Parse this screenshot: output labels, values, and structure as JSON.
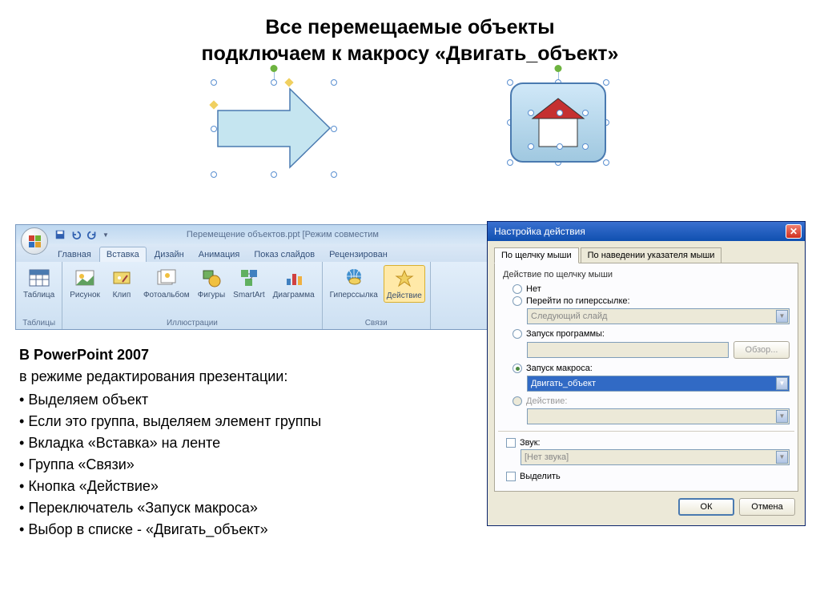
{
  "title_line1": "Все перемещаемые объекты",
  "title_line2": "подключаем к макросу «Двигать_объект»",
  "ribbon": {
    "file_title": "Перемещение объектов.ppt [Режим совместим",
    "tabs": [
      "Главная",
      "Вставка",
      "Дизайн",
      "Анимация",
      "Показ слайдов",
      "Рецензирован"
    ],
    "active_tab_index": 1,
    "groups": {
      "tables": {
        "label": "Таблицы",
        "items": [
          {
            "label": "Таблица"
          }
        ]
      },
      "illustrations": {
        "label": "Иллюстрации",
        "items": [
          {
            "label": "Рисунок"
          },
          {
            "label": "Клип"
          },
          {
            "label": "Фотоальбом"
          },
          {
            "label": "Фигуры"
          },
          {
            "label": "SmartArt"
          },
          {
            "label": "Диаграмма"
          }
        ]
      },
      "links": {
        "label": "Связи",
        "items": [
          {
            "label": "Гиперссылка"
          },
          {
            "label": "Действие",
            "selected": true
          }
        ]
      }
    }
  },
  "dialog": {
    "title": "Настройка действия",
    "tabs": [
      "По щелчку мыши",
      "По наведении указателя мыши"
    ],
    "active_tab_index": 0,
    "fieldset_label": "Действие по щелчку мыши",
    "radios": {
      "none": "Нет",
      "hyperlink": "Перейти по гиперссылке:",
      "hyperlink_value": "Следующий слайд",
      "run_program": "Запуск программы:",
      "browse": "Обзор...",
      "run_macro": "Запуск макроса:",
      "macro_value": "Двигать_объект",
      "action": "Действие:"
    },
    "selected_radio": "run_macro",
    "sound_label": "Звук:",
    "sound_value": "[Нет звука]",
    "highlight_label": "Выделить",
    "ok": "ОК",
    "cancel": "Отмена"
  },
  "instructions": {
    "heading": "В PowerPoint 2007",
    "subheading": "в режиме редактирования презентации:",
    "bullets": [
      "Выделяем объект",
      "Если это группа, выделяем элемент группы",
      "Вкладка «Вставка» на ленте",
      "Группа «Связи»",
      "Кнопка «Действие»",
      "Переключатель «Запуск макроса»",
      "Выбор в списке - «Двигать_объект»"
    ]
  }
}
